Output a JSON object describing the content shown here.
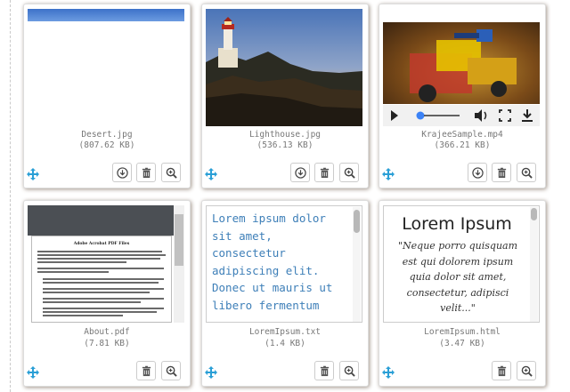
{
  "files": [
    {
      "name": "Desert.jpg",
      "size": "(807.62 KB)"
    },
    {
      "name": "Lighthouse.jpg",
      "size": "(536.13 KB)"
    },
    {
      "name": "KrajeeSample.mp4",
      "size": "(366.21 KB)"
    },
    {
      "name": "About.pdf",
      "size": "(7.81 KB)"
    },
    {
      "name": "LoremIpsum.txt",
      "size": "(1.4 KB)"
    },
    {
      "name": "LoremIpsum.html",
      "size": "(3.47 KB)"
    }
  ],
  "pdf_preview": {
    "title": "Adobe Acrobat PDF Files"
  },
  "txt_preview": {
    "text": "Lorem ipsum dolor sit amet, consectetur adipiscing elit. Donec ut mauris ut libero fermentum"
  },
  "html_preview": {
    "heading": "Lorem Ipsum",
    "quote": "\"Neque porro quisquam est qui dolorem ipsum quia dolor sit amet, consectetur, adipisci velit...\""
  },
  "icons": {
    "move": "move-icon",
    "download": "download-icon",
    "delete": "trash-icon",
    "zoom": "zoom-in-icon",
    "play": "play-icon",
    "volume": "volume-icon",
    "fullscreen": "fullscreen-icon"
  },
  "colors": {
    "accent": "#2a9fd6",
    "caption": "#777777",
    "text_preview": "#3e7fb8"
  }
}
